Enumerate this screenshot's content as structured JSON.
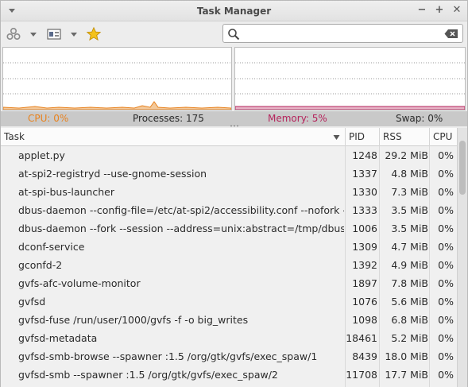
{
  "window": {
    "title": "Task Manager"
  },
  "stats": {
    "cpu": "CPU: 0%",
    "processes": "Processes: 175",
    "memory": "Memory: 5%",
    "swap": "Swap: 0%"
  },
  "colors": {
    "cpu": "#e8821e",
    "memory": "#b5245c"
  },
  "table": {
    "headers": {
      "task": "Task",
      "pid": "PID",
      "rss": "RSS",
      "cpu": "CPU"
    },
    "rows": [
      {
        "task": "applet.py",
        "pid": "1248",
        "rss": "29.2 MiB",
        "cpu": "0%"
      },
      {
        "task": "at-spi2-registryd --use-gnome-session",
        "pid": "1337",
        "rss": "4.8 MiB",
        "cpu": "0%"
      },
      {
        "task": "at-spi-bus-launcher",
        "pid": "1330",
        "rss": "7.3 MiB",
        "cpu": "0%"
      },
      {
        "task": "dbus-daemon --config-file=/etc/at-spi2/accessibility.conf --nofork --...",
        "pid": "1333",
        "rss": "3.5 MiB",
        "cpu": "0%"
      },
      {
        "task": "dbus-daemon --fork --session --address=unix:abstract=/tmp/dbus-...",
        "pid": "1006",
        "rss": "3.5 MiB",
        "cpu": "0%"
      },
      {
        "task": "dconf-service",
        "pid": "1309",
        "rss": "4.7 MiB",
        "cpu": "0%"
      },
      {
        "task": "gconfd-2",
        "pid": "1392",
        "rss": "4.9 MiB",
        "cpu": "0%"
      },
      {
        "task": "gvfs-afc-volume-monitor",
        "pid": "1897",
        "rss": "7.8 MiB",
        "cpu": "0%"
      },
      {
        "task": "gvfsd",
        "pid": "1076",
        "rss": "5.6 MiB",
        "cpu": "0%"
      },
      {
        "task": "gvfsd-fuse /run/user/1000/gvfs -f -o big_writes",
        "pid": "1098",
        "rss": "6.8 MiB",
        "cpu": "0%"
      },
      {
        "task": "gvfsd-metadata",
        "pid": "18461",
        "rss": "5.2 MiB",
        "cpu": "0%"
      },
      {
        "task": "gvfsd-smb-browse --spawner :1.5 /org/gtk/gvfs/exec_spaw/1",
        "pid": "8439",
        "rss": "18.0 MiB",
        "cpu": "0%"
      },
      {
        "task": "gvfsd-smb --spawner :1.5 /org/gtk/gvfs/exec_spaw/2",
        "pid": "11708",
        "rss": "17.7 MiB",
        "cpu": "0%"
      }
    ]
  }
}
